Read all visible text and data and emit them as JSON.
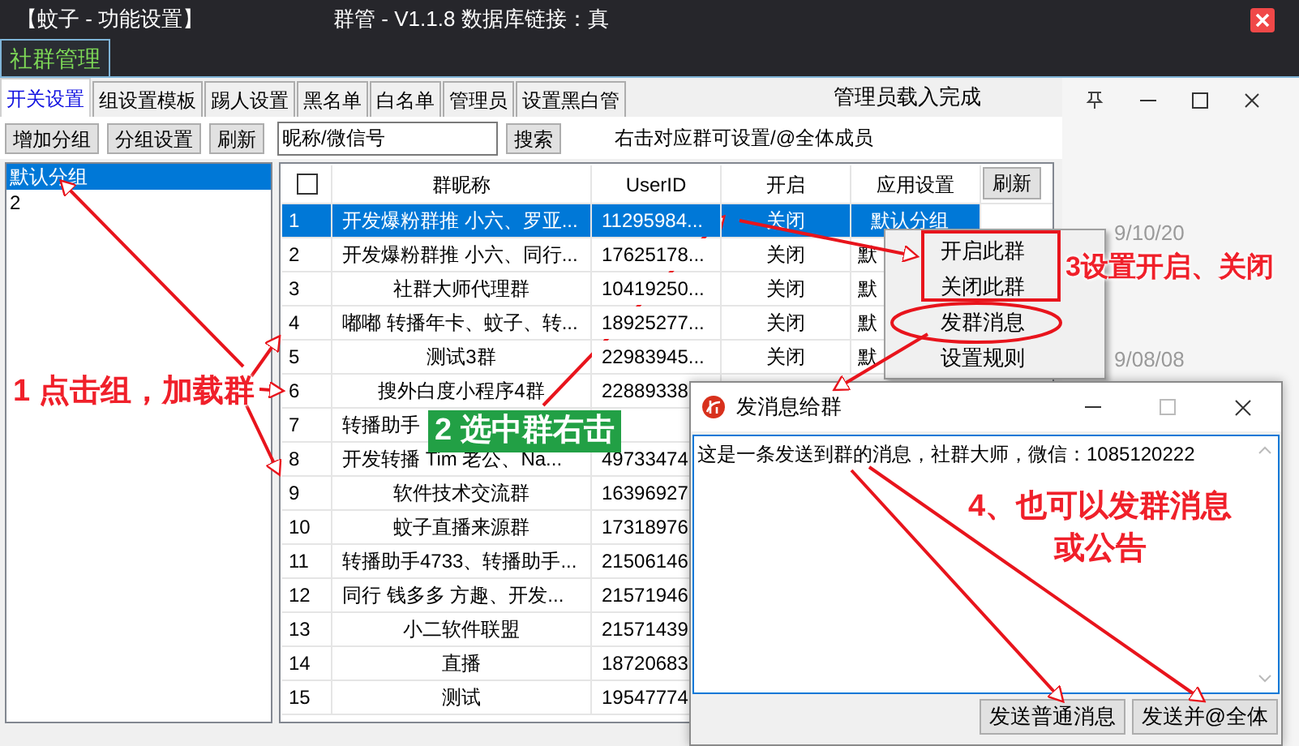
{
  "window": {
    "title": "【蚊子 - 功能设置】",
    "caption": "群管 - V1.1.8  数据库链接：真"
  },
  "main_tabs": [
    {
      "label": "社群管理",
      "selected": true
    }
  ],
  "tabs": [
    {
      "label": "开关设置",
      "selected": true
    },
    {
      "label": "组设置模板",
      "selected": false
    },
    {
      "label": "踢人设置",
      "selected": false
    },
    {
      "label": "黑名单",
      "selected": false
    },
    {
      "label": "白名单",
      "selected": false
    },
    {
      "label": "管理员",
      "selected": false
    },
    {
      "label": "设置黑白管",
      "selected": false
    }
  ],
  "status_message": "管理员载入完成",
  "toolbar": {
    "buttons": [
      "增加分组",
      "分组设置",
      "刷新"
    ],
    "search": {
      "value": "昵称/微信号"
    },
    "search_button": "搜索",
    "hint": "右击对应群可设置/@全体成员"
  },
  "groups": [
    {
      "label": "默认分组",
      "selected": true
    },
    {
      "label": "2",
      "selected": false
    }
  ],
  "table": {
    "header_checked": false,
    "columns": [
      "群昵称",
      "UserID",
      "开启",
      "应用设置"
    ],
    "refresh_button": "刷新",
    "rows": [
      {
        "index": "1",
        "name": "开发爆粉群推 小六、罗亚...",
        "overflow": true,
        "userid": "11295984...",
        "enabled": "关闭",
        "applied": "默认分组",
        "selected": true
      },
      {
        "index": "2",
        "name": "开发爆粉群推 小六、同行...",
        "overflow": true,
        "userid": "17625178...",
        "enabled": "关闭",
        "applied": "默",
        "selected": false
      },
      {
        "index": "3",
        "name": "社群大师代理群",
        "overflow": false,
        "userid": "10419250...",
        "enabled": "关闭",
        "applied": "默",
        "selected": false
      },
      {
        "index": "4",
        "name": "嘟嘟 转播年卡、蚊子、转...",
        "overflow": true,
        "userid": "18925277...",
        "enabled": "关闭",
        "applied": "默",
        "selected": false
      },
      {
        "index": "5",
        "name": "测试3群",
        "overflow": false,
        "userid": "22983945...",
        "enabled": "关闭",
        "applied": "默",
        "selected": false
      },
      {
        "index": "6",
        "name": "搜外白度小程序4群",
        "overflow": false,
        "userid": "22889338",
        "selected": false
      },
      {
        "index": "7",
        "name": "转播助手",
        "overflow": true,
        "selected": false
      },
      {
        "index": "8",
        "name": "开发转播 Tim 老公、Na...",
        "overflow": true,
        "userid": "49733474",
        "selected": false
      },
      {
        "index": "9",
        "name": "软件技术交流群",
        "overflow": false,
        "userid": "16396927",
        "selected": false
      },
      {
        "index": "10",
        "name": "蚊子直播来源群",
        "overflow": false,
        "userid": "17318976",
        "selected": false
      },
      {
        "index": "11",
        "name": "转播助手4733、转播助手...",
        "overflow": true,
        "userid": "21506146",
        "selected": false
      },
      {
        "index": "12",
        "name": "同行 钱多多 方趣、开发...",
        "overflow": true,
        "userid": "21571946",
        "selected": false
      },
      {
        "index": "13",
        "name": "小二软件联盟",
        "overflow": false,
        "userid": "21571439",
        "selected": false
      },
      {
        "index": "14",
        "name": "直播",
        "overflow": false,
        "userid": "18720683",
        "selected": false
      },
      {
        "index": "15",
        "name": "测试",
        "overflow": false,
        "userid": "19547774",
        "selected": false
      }
    ]
  },
  "context_menu": {
    "items": [
      "开启此群",
      "关闭此群",
      "发群消息",
      "设置规则"
    ]
  },
  "dialog": {
    "title": "发消息给群",
    "message": "这是一条发送到群的消息，社群大师，微信：1085120222",
    "buttons": [
      "发送普通消息",
      "发送并@全体"
    ]
  },
  "annotations": [
    {
      "kind": "red",
      "lines": [
        "1 点击组，加载群"
      ]
    },
    {
      "kind": "green",
      "lines": [
        "2 选中群右击"
      ]
    },
    {
      "kind": "red",
      "lines": [
        "3设置开启、关闭"
      ]
    },
    {
      "kind": "red",
      "lines": [
        "4、也可以发群消息",
        "或公告"
      ]
    }
  ],
  "background_window": {
    "dates": [
      "9/10/20",
      "9/08/08"
    ]
  }
}
